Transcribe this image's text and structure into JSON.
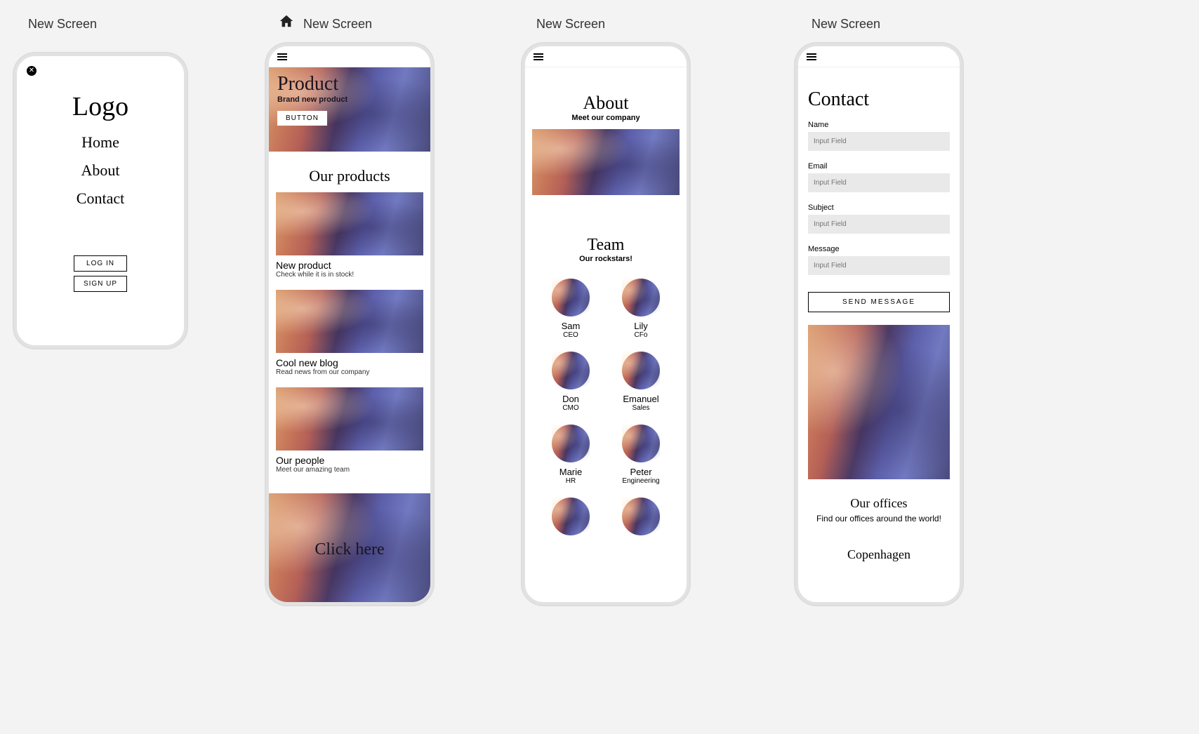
{
  "labels": {
    "s1": "New Screen",
    "s2": "New Screen",
    "s3": "New Screen",
    "s4": "New Screen"
  },
  "screen1": {
    "logo": "Logo",
    "menu": [
      "Home",
      "About",
      "Contact"
    ],
    "login": "LOG IN",
    "signup": "SIGN UP"
  },
  "screen2": {
    "hero_title": "Product",
    "hero_sub": "Brand new product",
    "hero_btn": "BUTTON",
    "section_title": "Our products",
    "cards": [
      {
        "title": "New product",
        "desc": "Check while it is in stock!"
      },
      {
        "title": "Cool new blog",
        "desc": "Read news from our company"
      },
      {
        "title": "Our people",
        "desc": "Meet our amazing team"
      }
    ],
    "cta": "Click here"
  },
  "screen3": {
    "about_title": "About",
    "about_sub": "Meet our company",
    "team_title": "Team",
    "team_sub": "Our rockstars!",
    "members": [
      {
        "name": "Sam",
        "role": "CEO"
      },
      {
        "name": "Lily",
        "role": "CFo"
      },
      {
        "name": "Don",
        "role": "CMO"
      },
      {
        "name": "Emanuel",
        "role": "Sales"
      },
      {
        "name": "Marie",
        "role": "HR"
      },
      {
        "name": "Peter",
        "role": "Engineering"
      },
      {
        "name": "",
        "role": ""
      },
      {
        "name": "",
        "role": ""
      }
    ]
  },
  "screen4": {
    "title": "Contact",
    "fields": [
      {
        "label": "Name",
        "placeholder": "Input Field"
      },
      {
        "label": "Email",
        "placeholder": "Input Field"
      },
      {
        "label": "Subject",
        "placeholder": "Input Field"
      },
      {
        "label": "Message",
        "placeholder": "Input Field"
      }
    ],
    "send": "SEND MESSAGE",
    "offices_title": "Our offices",
    "offices_sub": "Find our offices around the world!",
    "city": "Copenhagen"
  }
}
